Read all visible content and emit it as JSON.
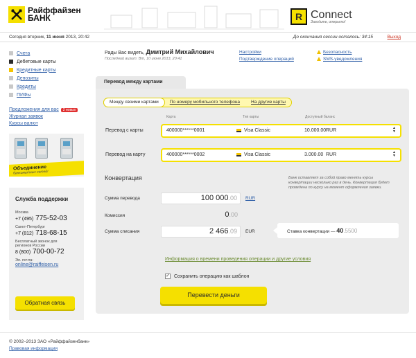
{
  "header": {
    "bank_name_line1": "Райффайзен",
    "bank_name_line2": "БАНК",
    "connect_title": "Connect",
    "connect_tagline": "Заходите, открыто!",
    "brand_color": "#f5e000"
  },
  "session": {
    "today_prefix": "Сегодня вторник,",
    "today_date": "11 июня",
    "today_time": "2013, 20:42",
    "remaining_label": "До окончания сессии осталось:",
    "remaining_value": "34:15",
    "logout": "Выход"
  },
  "leftnav": {
    "items": [
      {
        "label": "Счета",
        "color": "#c8c8c8"
      },
      {
        "label": "Дебетовые карты",
        "color": "#2a2a2a"
      },
      {
        "label": "Кредитные карты",
        "color": "#f5c400"
      },
      {
        "label": "Депозиты",
        "color": "#c8c8c8"
      },
      {
        "label": "Кредиты",
        "color": "#c8c8c8"
      },
      {
        "label": "ПИФы",
        "color": "#c8c8c8"
      }
    ],
    "offers_link": "Предложения для вас",
    "offers_badge": "2 новых",
    "journal_link": "Журнал заявок",
    "rates_link": "Курсы валют"
  },
  "atm_banner": {
    "title": "Объединение",
    "subtitle": "банкоматных сетей!"
  },
  "support": {
    "title": "Служба поддержки",
    "moscow_label": "Москва",
    "moscow_code": "+7 (495)",
    "moscow_number": "775-52-03",
    "spb_label": "Санкт-Петербург",
    "spb_code": "+7 (812)",
    "spb_number": "718-68-15",
    "free_label_1": "Бесплатный звонок для",
    "free_label_2": "регионов России",
    "free_code": "8 (800)",
    "free_number": "700-00-72",
    "email_label": "Эл. почта:",
    "email": "online@raiffeisen.ru",
    "feedback_button": "Обратная связь"
  },
  "welcome": {
    "greeting": "Рады Вас видеть,",
    "user_name": "Дмитрий Михайлович",
    "last_visit": "Последний визит: Вт, 10 июня 2013, 20:41"
  },
  "top_links": {
    "settings": "Настройки",
    "confirmation": "Подтверждение операций",
    "security": "Безопасность",
    "sms": "SMS-уведомления"
  },
  "transfer": {
    "tab_label": "Перевод между картами",
    "subtabs": [
      "Между своими картами",
      "По номеру мобильного телефона",
      "На другие карты"
    ],
    "col_card": "Карта",
    "col_type": "Тип карты",
    "col_balance": "Доступный баланс",
    "from_label": "Перевод с карты",
    "from_card": "400000******0001",
    "from_type": "Visa Classic",
    "from_balance": "10.000.00",
    "from_currency": "RUR",
    "to_label": "Перевод на карту",
    "to_card": "400000******0002",
    "to_type": "Visa Classic",
    "to_balance": "3.000.00",
    "to_currency": "RUR",
    "conversion_title": "Конвертация",
    "conversion_note": "Банк оставляет за собой право менять курсы конвертации несколько раз в день. Конвертация будет проведена по курсу на момент оформления заявки.",
    "amount_label": "Сумма перевода",
    "amount_value": "100 000",
    "amount_cents": ".00",
    "amount_currency": "RUR",
    "fee_label": "Комиссия",
    "fee_value": "0",
    "fee_cents": ".00",
    "debit_label": "Сумма списания",
    "debit_value": "2 466",
    "debit_cents": ".09",
    "debit_currency": "EUR",
    "rate_label": "Ставка конвертации —",
    "rate_value": "40",
    "rate_cents": ".5500",
    "info_link": "Информация о времени проведения операции и другие условия",
    "save_template": "Сохранить операцию как шаблон",
    "submit": "Перевести деньги"
  },
  "footer": {
    "copyright": "© 2002–2013 ЗАО «Райффайзенбанк»",
    "legal_link": "Правовая информация"
  }
}
